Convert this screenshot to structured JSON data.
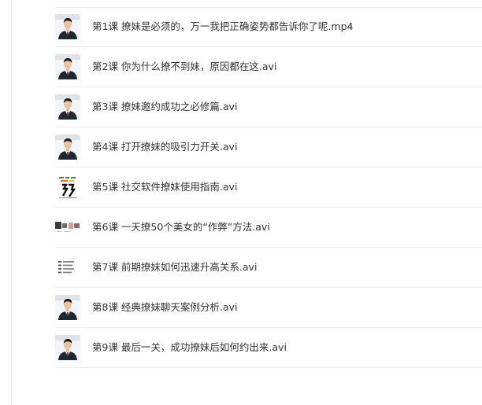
{
  "colors": {
    "text": "#333333",
    "divider": "#efefef",
    "suit": "#1f2730",
    "backdrop": "#f2f4f7"
  },
  "files": [
    {
      "name": "第1课 撩妹是必须的，万一我把正确姿势都告诉你了呢.mp4",
      "thumb": "presenter"
    },
    {
      "name": "第2课 你为什么撩不到妹，原因都在这.avi",
      "thumb": "presenter"
    },
    {
      "name": "第3课 撩妹邀约成功之必修篇.avi",
      "thumb": "presenter"
    },
    {
      "name": "第4课 打开撩妹的吸引力开关.avi",
      "thumb": "presenter"
    },
    {
      "name": "第5课 社交软件撩妹使用指南.avi",
      "thumb": "cover-slide"
    },
    {
      "name": "第6课 一天撩50个美女的“作弊”方法.avi",
      "thumb": "chat-screens"
    },
    {
      "name": "第7课 前期撩妹如何迅速升高关系.avi",
      "thumb": "text-slide"
    },
    {
      "name": "第8课 经典撩妹聊天案例分析.avi",
      "thumb": "presenter"
    },
    {
      "name": "第9课 最后一关，成功撩妹后如何约出来.avi",
      "thumb": "presenter"
    }
  ]
}
